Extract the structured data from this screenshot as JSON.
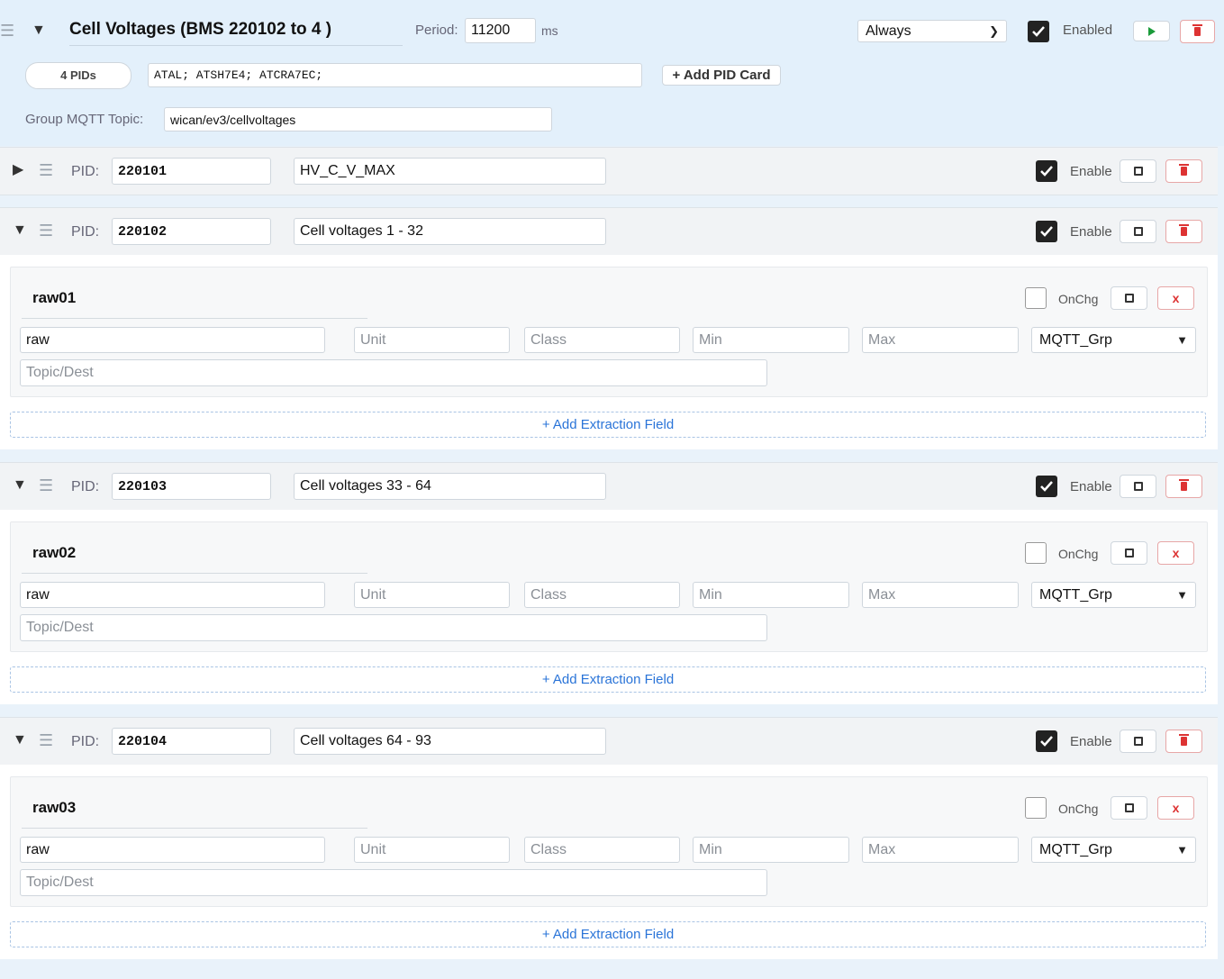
{
  "group": {
    "title": "Cell Voltages (BMS 220102 to 4 )",
    "period_label": "Period:",
    "period_value": "11200",
    "period_unit": "ms",
    "trigger_selected": "Always",
    "enabled_label": "Enabled",
    "enabled": true,
    "pid_count": "4 PIDs",
    "init_commands": "ATAL; ATSH7E4; ATCRA7EC;",
    "add_pid_card_label": "+ Add PID Card",
    "mqtt_topic_label": "Group MQTT Topic:",
    "mqtt_topic_value": "wican/ev3/cellvoltages"
  },
  "labels": {
    "pid": "PID:",
    "enable": "Enable",
    "onchg": "OnChg",
    "add_extraction_field": "+ Add Extraction Field"
  },
  "placeholders": {
    "unit": "Unit",
    "class": "Class",
    "min": "Min",
    "max": "Max",
    "topic": "Topic/Dest"
  },
  "pids": [
    {
      "pid": "220101",
      "name": "HV_C_V_MAX",
      "enabled": true,
      "expanded": false
    },
    {
      "pid": "220102",
      "name": "Cell voltages 1 - 32",
      "enabled": true,
      "expanded": true,
      "field": {
        "name": "raw01",
        "expr": "raw",
        "onchg": false,
        "dest": "MQTT_Grp"
      }
    },
    {
      "pid": "220103",
      "name": "Cell voltages 33 - 64",
      "enabled": true,
      "expanded": true,
      "field": {
        "name": "raw02",
        "expr": "raw",
        "onchg": false,
        "dest": "MQTT_Grp"
      }
    },
    {
      "pid": "220104",
      "name": "Cell voltages 64 - 93",
      "enabled": true,
      "expanded": true,
      "field": {
        "name": "raw03",
        "expr": "raw",
        "onchg": false,
        "dest": "MQTT_Grp"
      }
    }
  ]
}
